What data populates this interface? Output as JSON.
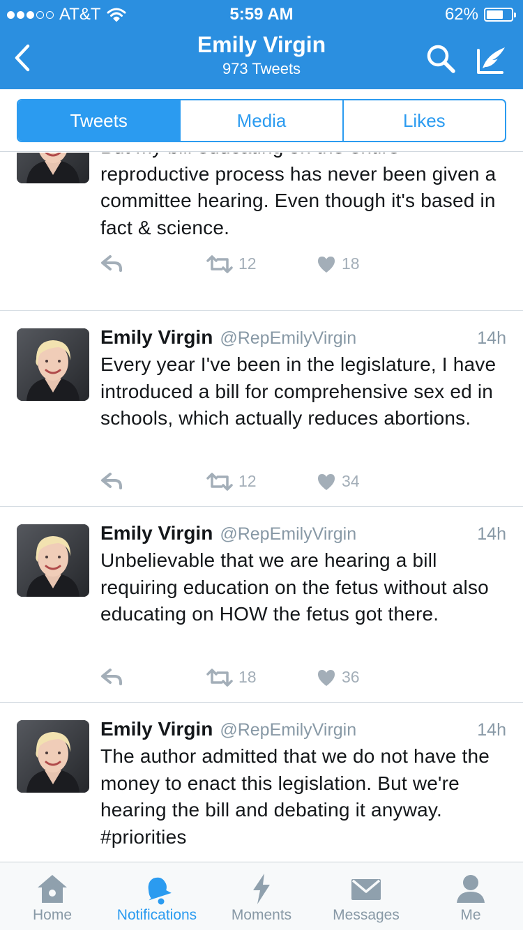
{
  "status_bar": {
    "carrier": "AT&T",
    "time": "5:59 AM",
    "battery": "62%",
    "signal_bars_filled": 3,
    "signal_bars_total": 5
  },
  "nav": {
    "title": "Emily Virgin",
    "subtitle": "973 Tweets",
    "icons": [
      "chevron-left-icon",
      "search-icon",
      "compose-icon"
    ]
  },
  "tabs": [
    {
      "label": "Tweets",
      "active": true
    },
    {
      "label": "Media",
      "active": false
    },
    {
      "label": "Likes",
      "active": false
    }
  ],
  "tweets": [
    {
      "name": "",
      "handle": "",
      "time": "",
      "text": "But my bill educating on the entire reproductive process has never been given a committee hearing. Even though it's based in fact & science.",
      "retweets": "12",
      "likes": "18"
    },
    {
      "name": "Emily Virgin",
      "handle": "@RepEmilyVirgin",
      "time": "14h",
      "text": "Every year I've been in the legislature, I have introduced a bill for comprehensive sex ed in schools, which actually reduces abortions.",
      "retweets": "12",
      "likes": "34"
    },
    {
      "name": "Emily Virgin",
      "handle": "@RepEmilyVirgin",
      "time": "14h",
      "text": "Unbelievable that we are hearing a bill requiring education on the fetus without also educating on HOW the fetus got there.",
      "retweets": "18",
      "likes": "36"
    },
    {
      "name": "Emily Virgin",
      "handle": "@RepEmilyVirgin",
      "time": "14h",
      "text": "The author admitted that we do not have the money to enact this legislation. But we're hearing the bill and debating it anyway. #priorities",
      "retweets": "",
      "likes": ""
    }
  ],
  "tabbar": [
    {
      "label": "Home",
      "icon": "home-icon",
      "active": false
    },
    {
      "label": "Notifications",
      "icon": "bell-icon",
      "active": true
    },
    {
      "label": "Moments",
      "icon": "lightning-icon",
      "active": false
    },
    {
      "label": "Messages",
      "icon": "envelope-icon",
      "active": false
    },
    {
      "label": "Me",
      "icon": "person-icon",
      "active": false
    }
  ],
  "colors": {
    "brand": "#2b8fe0",
    "accent": "#2b9bf0",
    "secondary_text": "#8899a6",
    "action_icon": "#a3aeb8"
  }
}
